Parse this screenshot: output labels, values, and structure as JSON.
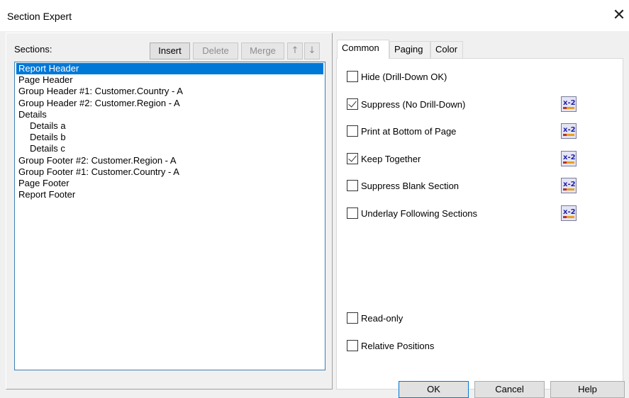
{
  "window": {
    "title": "Section Expert"
  },
  "sections": {
    "label": "Sections:",
    "toolbar": {
      "insert": "Insert",
      "delete": "Delete",
      "merge": "Merge",
      "up": "↑",
      "down": "↓"
    },
    "items": [
      {
        "label": "Report Header",
        "selected": true,
        "indent": false
      },
      {
        "label": "Page Header",
        "selected": false,
        "indent": false
      },
      {
        "label": "Group Header #1: Customer.Country - A",
        "selected": false,
        "indent": false
      },
      {
        "label": "Group Header #2: Customer.Region - A",
        "selected": false,
        "indent": false
      },
      {
        "label": "Details",
        "selected": false,
        "indent": false
      },
      {
        "label": "Details a",
        "selected": false,
        "indent": true
      },
      {
        "label": "Details b",
        "selected": false,
        "indent": true
      },
      {
        "label": "Details c",
        "selected": false,
        "indent": true
      },
      {
        "label": "Group Footer #2: Customer.Region - A",
        "selected": false,
        "indent": false
      },
      {
        "label": "Group Footer #1: Customer.Country - A",
        "selected": false,
        "indent": false
      },
      {
        "label": "Page Footer",
        "selected": false,
        "indent": false
      },
      {
        "label": "Report Footer",
        "selected": false,
        "indent": false
      }
    ]
  },
  "tabs": [
    {
      "label": "Common",
      "active": true
    },
    {
      "label": "Paging",
      "active": false
    },
    {
      "label": "Color",
      "active": false
    }
  ],
  "common": {
    "options": [
      {
        "label": "Hide (Drill-Down OK)",
        "checked": false,
        "formula": false
      },
      {
        "label": "Suppress (No Drill-Down)",
        "checked": true,
        "formula": true
      },
      {
        "label": "Print at Bottom of Page",
        "checked": false,
        "formula": true
      },
      {
        "label": "Keep Together",
        "checked": true,
        "formula": true
      },
      {
        "label": "Suppress Blank Section",
        "checked": false,
        "formula": true
      },
      {
        "label": "Underlay Following Sections",
        "checked": false,
        "formula": true
      }
    ],
    "bottom_options": [
      {
        "label": "Read-only",
        "checked": false
      },
      {
        "label": "Relative Positions",
        "checked": false
      }
    ],
    "formula_icon": "formula-editor-icon",
    "formula_icon_text": "x-2"
  },
  "buttons": {
    "ok": "OK",
    "cancel": "Cancel",
    "help": "Help"
  },
  "colors": {
    "selection": "#0078d7",
    "list_border": "#3c7fb1"
  }
}
